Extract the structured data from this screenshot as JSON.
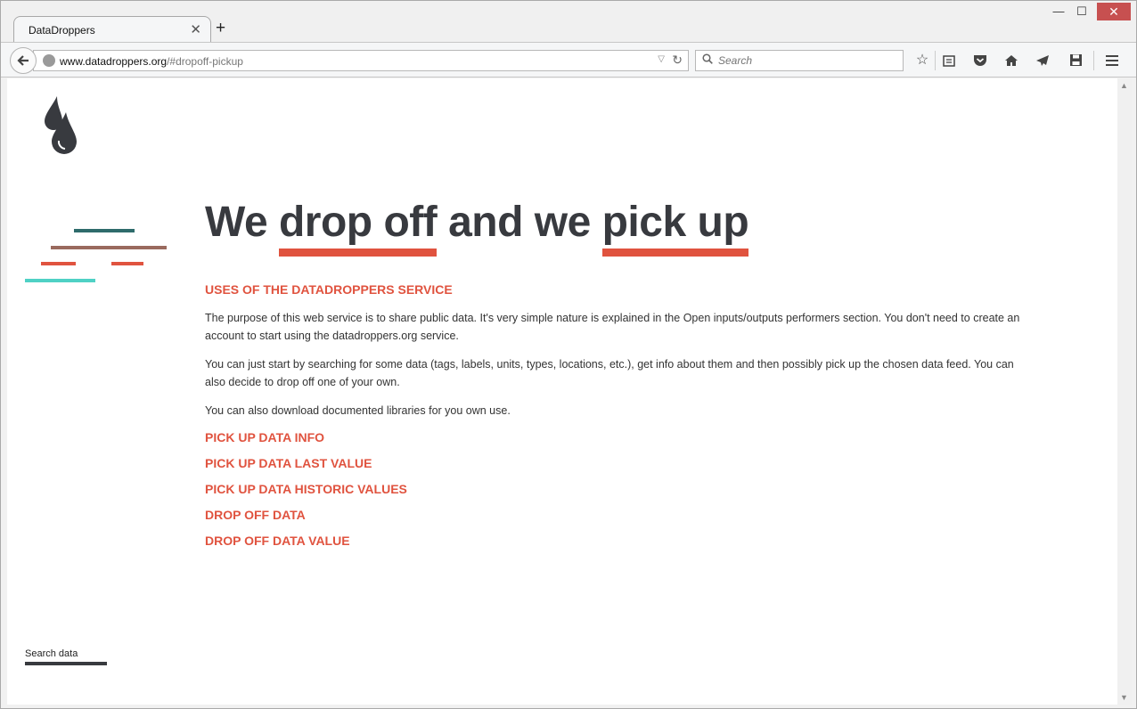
{
  "browser": {
    "tab_title": "DataDroppers",
    "tab_close": "✕",
    "new_tab": "+",
    "url_domain": "www.datadroppers.org",
    "url_path": "/#dropoff-pickup",
    "search_placeholder": "Search",
    "window_controls": {
      "minimize": "—",
      "maximize": "☐",
      "close": "✕"
    },
    "toolbar_icons": [
      "star-icon",
      "reading-list-icon",
      "pocket-icon",
      "home-icon",
      "send-icon",
      "save-icon",
      "menu-icon"
    ]
  },
  "page": {
    "hero": {
      "w1": "We ",
      "w2": "drop off",
      "w3": " and we ",
      "w4": "pick up"
    },
    "sections": {
      "uses_title": "USES OF THE DATADROPPERS SERVICE",
      "p1": "The purpose of this web service is to share public data. It's very simple nature is explained in the Open inputs/outputs performers section. You don't need to create an account to start using the datadroppers.org service.",
      "p2": "You can just start by searching for some data (tags, labels, units, types, locations, etc.), get info about them and then possibly pick up the chosen data feed. You can also decide to drop off one of your own.",
      "p3": "You can also download documented libraries for you own use.",
      "links": [
        "PICK UP DATA INFO",
        "PICK UP DATA LAST VALUE",
        "PICK UP DATA HISTORIC VALUES",
        "DROP OFF DATA",
        "DROP OFF DATA VALUE"
      ]
    },
    "search_data": "Search data",
    "colors": {
      "accent": "#e0533f",
      "text_dark": "#383a3f",
      "stripe_teal": "#2e6b6b",
      "stripe_brown": "#9a6a5e",
      "stripe_aqua": "#4fd1c5"
    }
  }
}
